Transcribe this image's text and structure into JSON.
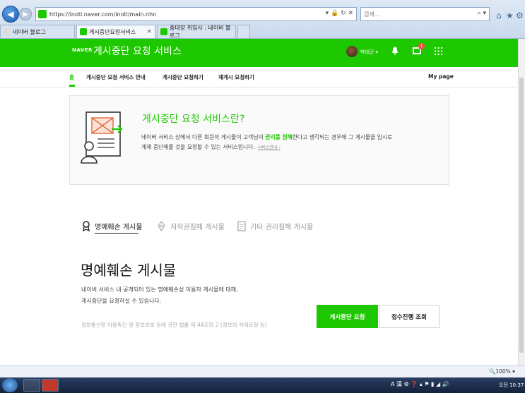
{
  "browser": {
    "url": "https://inoti.naver.com/inoti/main.nhn",
    "search_placeholder": "검색...",
    "tabs": [
      {
        "label": "네이버 블로그"
      },
      {
        "label": "게시중단요청서비스"
      },
      {
        "label": "중대장 취임사 : 네이버 블로그"
      }
    ],
    "zoom": "100%"
  },
  "header": {
    "brand": "NAVER",
    "service_title": "게시중단 요청 서비스",
    "user_name": "박대군",
    "mail_count": "1"
  },
  "subnav": {
    "items": [
      {
        "label": "홈"
      },
      {
        "label": "게시중단 요청 서비스 안내"
      },
      {
        "label": "게시중단 요청하기"
      },
      {
        "label": "재게시 요청하기"
      }
    ],
    "mypage": "My page"
  },
  "info": {
    "title": "게시중단 요청 서비스란?",
    "text_before": "네이버 서비스 상에서 다른 회원의 게시물이 고객님의 ",
    "text_highlight": "권리를 침해",
    "text_after": "한다고 생각되는 경우에 그 게시물을 임시로",
    "text_line2": "게재 중단해줄 것을 요청할 수 있는 서비스입니다.",
    "more_link": "서비스안내 ›"
  },
  "category_tabs": [
    {
      "label": "명예훼손 게시물"
    },
    {
      "label": "저작권침해 게시물"
    },
    {
      "label": "기타 권리침해 게시물"
    }
  ],
  "section": {
    "title": "명예훼손 게시물",
    "desc_line1": "네이버 서비스 내 공개되어 있는 명예훼손성 이용자 게시물에 대해,",
    "desc_line2": "게시중단을 요청하실 수 있습니다.",
    "note": "정보통신망 이용촉진 및 정보보호 등에 관한 법률 제 44조의 2 (정보의 삭제요청 등)",
    "request_button": "게시중단 요청",
    "check_button": "접수진행 조회"
  },
  "taskbar": {
    "ime": "A 漢",
    "clock": "오전 10:37"
  },
  "colors": {
    "naver_green": "#1ec800"
  }
}
